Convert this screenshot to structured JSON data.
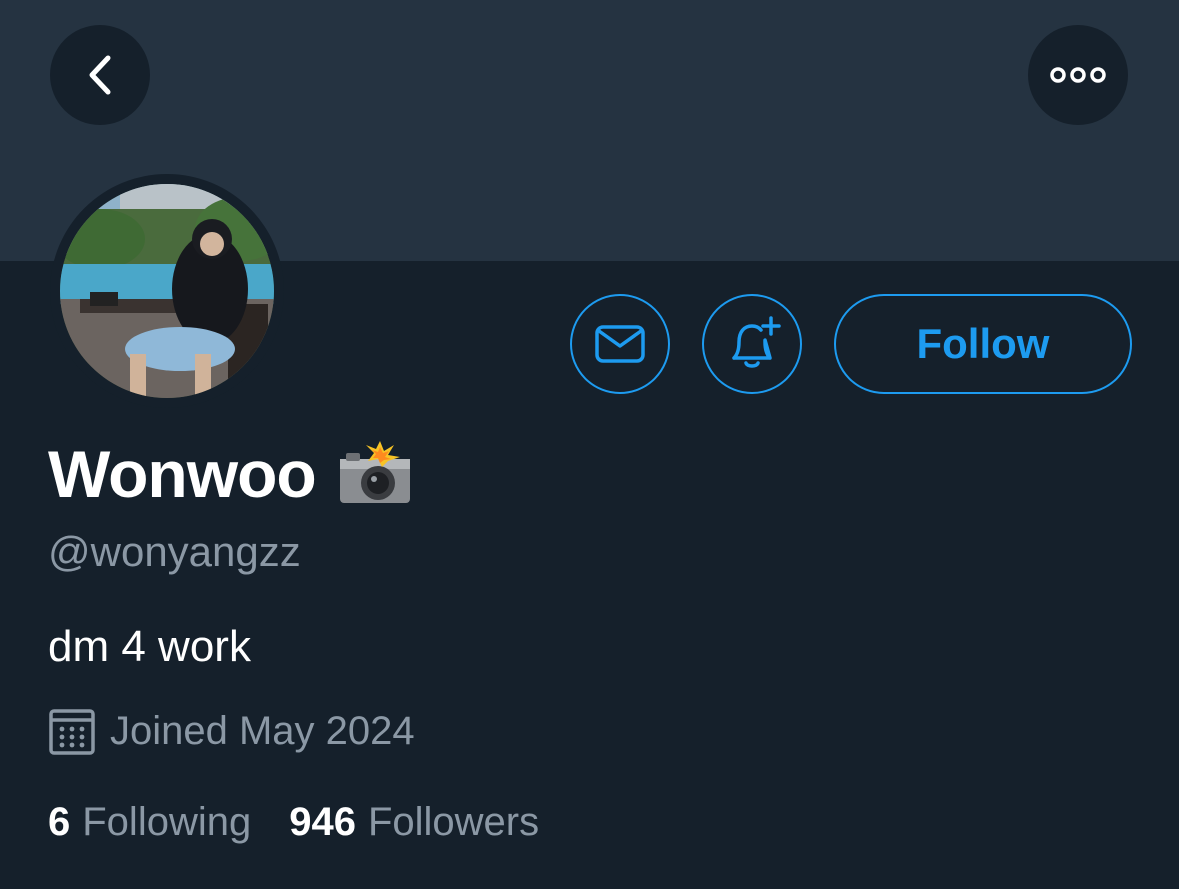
{
  "profile": {
    "display_name": "Wonwoo",
    "name_emoji": "camera-with-flash",
    "handle": "@wonyangzz",
    "bio": "dm 4 work",
    "joined": "Joined May 2024"
  },
  "actions": {
    "follow_label": "Follow",
    "message_icon": "envelope-icon",
    "notify_icon": "bell-plus-icon"
  },
  "header": {
    "back_icon": "chevron-left-icon",
    "more_icon": "more-dots-icon"
  },
  "stats": {
    "following_count": "6",
    "following_label": "Following",
    "followers_count": "946",
    "followers_label": "Followers"
  },
  "colors": {
    "background": "#15202b",
    "banner": "#253341",
    "accent": "#1d9bf0",
    "secondary_text": "#8b98a5"
  }
}
